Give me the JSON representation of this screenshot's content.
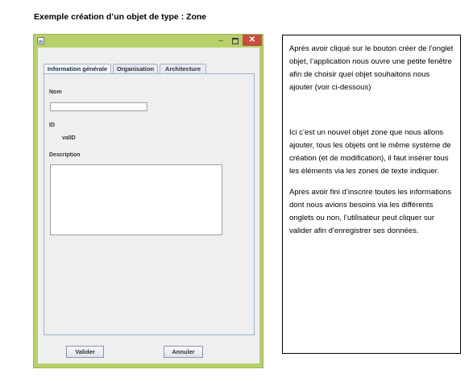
{
  "heading": "Exemple  création d’un objet de type : Zone",
  "window": {
    "icon": "java-app-icon",
    "controls": {
      "minimize": "–",
      "maximize": "□",
      "close": "✕"
    },
    "tabs": [
      {
        "label": "Information générale",
        "active": true
      },
      {
        "label": "Organisation",
        "active": false
      },
      {
        "label": "Architecture",
        "active": false
      }
    ],
    "fields": {
      "nom_label": "Nom",
      "nom_value": "",
      "id_label": "ID",
      "id_value": "valID",
      "description_label": "Description",
      "description_value": ""
    },
    "buttons": {
      "valider": "Valider",
      "annuler": "Annuler"
    },
    "colors": {
      "frame": "#b7d069",
      "close": "#c74f3f",
      "tab_border": "#9fb1c9"
    }
  },
  "note": {
    "p1": "Après avoir cliqué sur le bouton créer de l’onglet objet, l’application nous ouvre une petite fenêtre afin de choisir quel objet souhaitons nous ajouter (voir ci-dessous)",
    "p2": "Ici c’est un nouvel objet zone que nous allons ajouter, tous les objets ont le même système de création (et de modification), il faut insérer tous les éléments via les  zones de texte indiquer.",
    "p3": "Apres avoir fini d’inscrire toutes les informations dont nous avions besoins via les différents onglets ou non, l’utilisateur peut cliquer sur valider afin d’enregistrer ses données."
  }
}
